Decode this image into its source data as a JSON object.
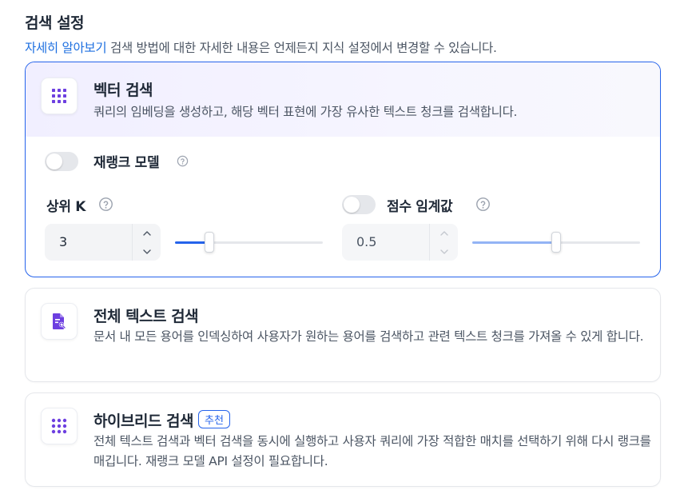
{
  "header": {
    "title": "검색 설정",
    "learn_more": "자세히 알아보기",
    "description": " 검색 방법에 대한 자세한 내용은 언제든지 지식 설정에서 변경할 수 있습니다."
  },
  "vector_search": {
    "title": "벡터 검색",
    "description": "쿼리의 임베딩을 생성하고, 해당 벡터 표현에 가장 유사한 텍스트 청크를 검색합니다.",
    "rerank": {
      "label": "재랭크 모델",
      "enabled": false
    },
    "top_k": {
      "label": "상위 K",
      "value": "3",
      "slider_fraction": 0.23
    },
    "score_threshold": {
      "label": "점수 임계값",
      "enabled": false,
      "value": "0.5",
      "slider_fraction": 0.5
    }
  },
  "full_text_search": {
    "title": "전체 텍스트 검색",
    "description": "문서 내 모든 용어를 인덱싱하여 사용자가 원하는 용어를 검색하고 관련 텍스트 청크를 가져올 수 있게 합니다."
  },
  "hybrid_search": {
    "title": "하이브리드 검색",
    "badge": "추천",
    "description": "전체 텍스트 검색과 벡터 검색을 동시에 실행하고 사용자 쿼리에 가장 적합한 매치를 선택하기 위해 다시 랭크를 매깁니다. 재랭크 모델 API 설정이 필요합니다."
  },
  "colors": {
    "accent": "#2563eb",
    "icon_purple": "#6d3fe0",
    "slider_active": "#2563eb",
    "slider_disabled": "#93b4f5"
  },
  "icons": [
    "grid-dots-icon",
    "document-search-icon",
    "help-circle-icon",
    "chevron-up-icon",
    "chevron-down-icon"
  ]
}
